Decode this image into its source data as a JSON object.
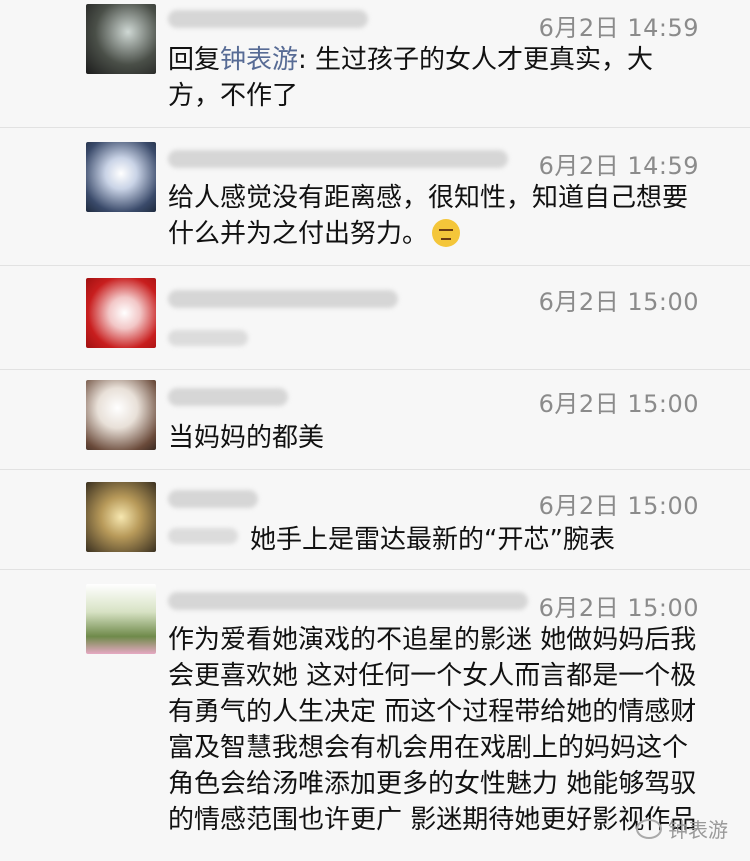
{
  "comments": [
    {
      "time": "6月2日 14:59",
      "reply_prefix": "回复",
      "reply_name": "钟表游",
      "reply_text": ": 生过孩子的女人才更真实，大方，不作了"
    },
    {
      "time": "6月2日 14:59",
      "text": "给人感觉没有距离感，很知性，知道自己想要什么并为之付出努力。"
    },
    {
      "time": "6月2日 15:00",
      "text": ""
    },
    {
      "time": "6月2日 15:00",
      "text": "当妈妈的都美"
    },
    {
      "time": "6月2日 15:00",
      "text": "她手上是雷达最新的“开芯”腕表"
    },
    {
      "time": "6月2日 15:00",
      "text": "作为爱看她演戏的不追星的影迷 她做妈妈后我会更喜欢她 这对任何一个女人而言都是一个极有勇气的人生决定 而这个过程带给她的情感财富及智慧我想会有机会用在戏剧上的妈妈这个角色会给汤唯添加更多的女性魅力 她能够驾驭的情感范围也许更广 影迷期待她更好影视作品"
    }
  ],
  "watermark": {
    "text": "钟表游",
    "icon": "wechat-icon"
  }
}
